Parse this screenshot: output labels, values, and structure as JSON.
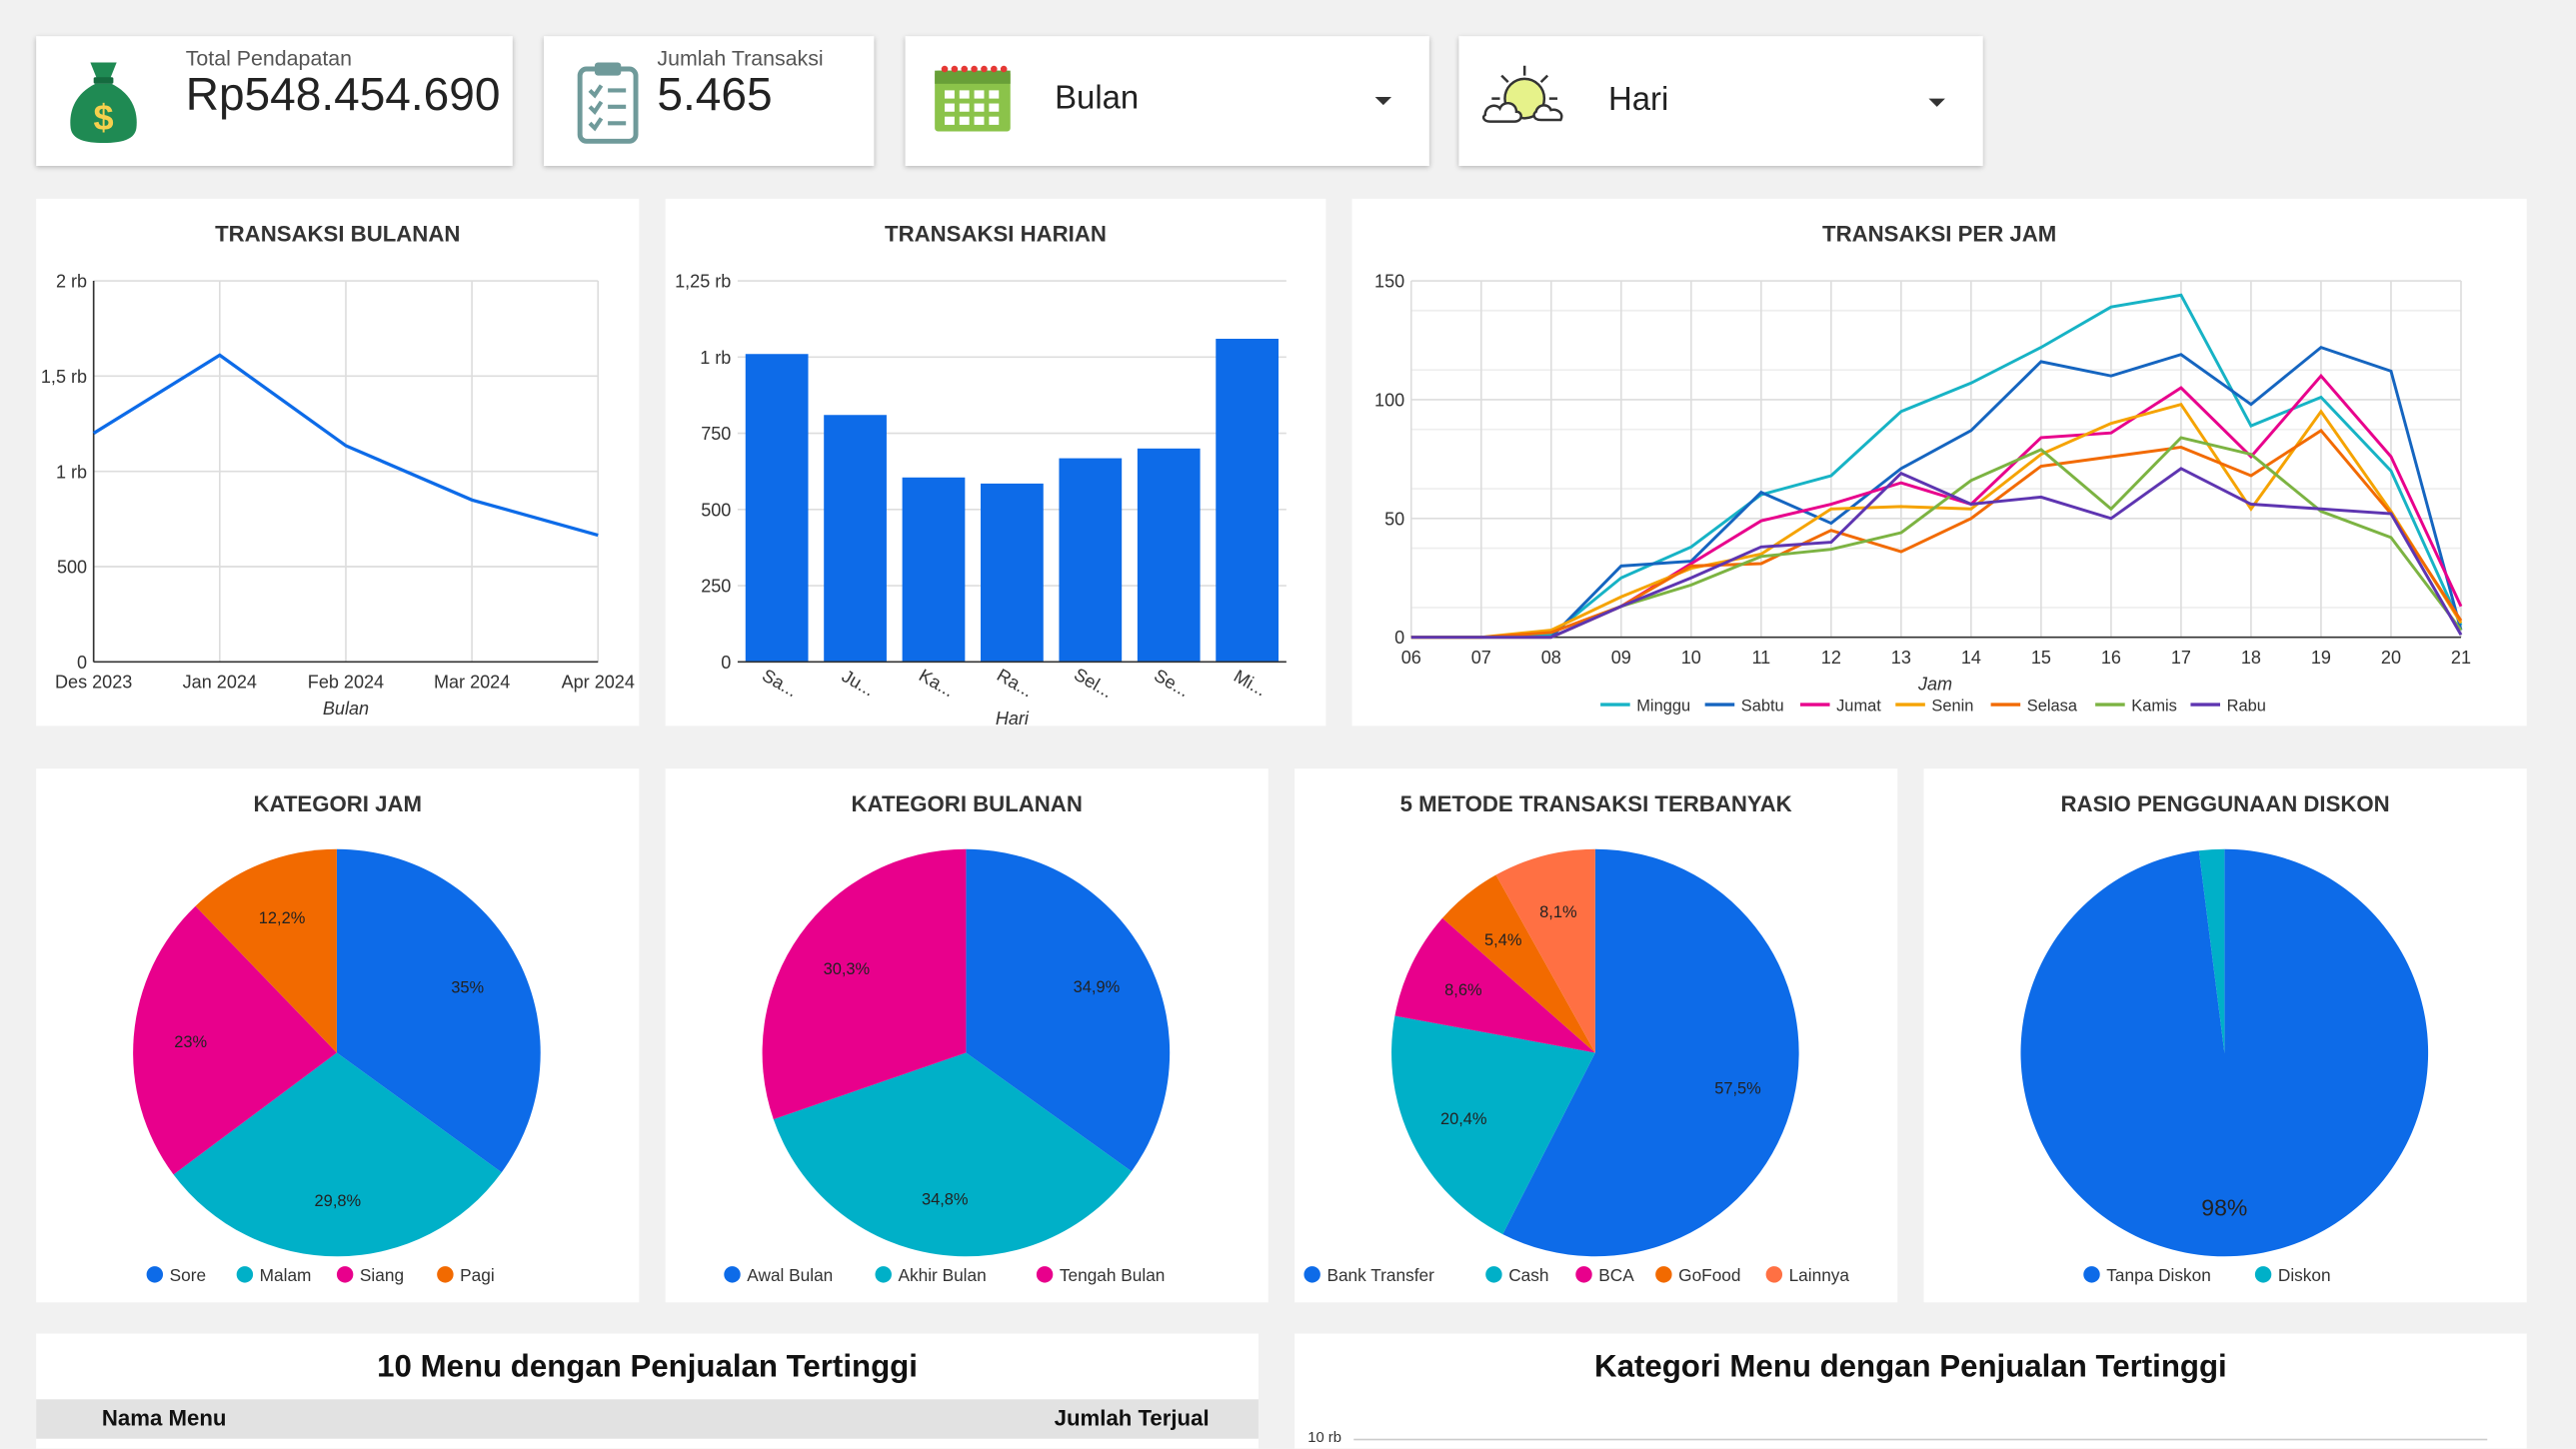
{
  "kpis": {
    "revenue": {
      "label": "Total Pendapatan",
      "value": "Rp548.454.690",
      "icon": "money-bag-icon"
    },
    "transactions": {
      "label": "Jumlah Transaksi",
      "value": "5.465",
      "icon": "clipboard-list-icon"
    }
  },
  "filters": {
    "month": {
      "value": "Bulan",
      "icon": "calendar-icon"
    },
    "day": {
      "value": "Hari",
      "icon": "sun-cloud-icon"
    }
  },
  "colors": {
    "blue": "#0d6be8",
    "teal": "#00b0c8",
    "pink": "#e8008c",
    "orange": "#f26a00",
    "amber": "#f5a300",
    "coral": "#ff7043",
    "green": "#7cb342",
    "purple": "#5e35b1",
    "darkblue": "#1565c0",
    "cyan": "#17b3c5"
  },
  "chart_data": [
    {
      "id": "monthly",
      "type": "line",
      "title": "TRANSAKSI BULANAN",
      "xlabel": "Bulan",
      "ylabel": "",
      "categories": [
        "Des 2023",
        "Jan 2024",
        "Feb 2024",
        "Mar 2024",
        "Apr 2024"
      ],
      "values": [
        1200,
        1610,
        1135,
        850,
        665
      ],
      "ylim": [
        0,
        2000
      ],
      "yticks": [
        0,
        500,
        1000,
        1500,
        2000
      ],
      "ytick_labels": [
        "0",
        "500",
        "1 rb",
        "1,5 rb",
        "2 rb"
      ],
      "grid": true,
      "color": "#0d6be8"
    },
    {
      "id": "daily",
      "type": "bar",
      "title": "TRANSAKSI HARIAN",
      "xlabel": "Hari",
      "ylabel": "",
      "categories": [
        "Sa...",
        "Ju...",
        "Ka...",
        "Ra...",
        "Sel...",
        "Se...",
        "Mi..."
      ],
      "values": [
        1010,
        810,
        605,
        585,
        668,
        700,
        1060
      ],
      "ylim": [
        0,
        1250
      ],
      "yticks": [
        0,
        250,
        500,
        750,
        1000,
        1250
      ],
      "ytick_labels": [
        "0",
        "250",
        "500",
        "750",
        "1 rb",
        "1,25 rb"
      ],
      "grid": true,
      "color": "#0d6be8"
    },
    {
      "id": "hourly",
      "type": "line",
      "title": "TRANSAKSI PER JAM",
      "xlabel": "Jam",
      "ylabel": "",
      "categories": [
        "06",
        "07",
        "08",
        "09",
        "10",
        "11",
        "12",
        "13",
        "14",
        "15",
        "16",
        "17",
        "18",
        "19",
        "20",
        "21"
      ],
      "ylim": [
        0,
        150
      ],
      "yticks": [
        0,
        50,
        100,
        150
      ],
      "ytick_labels": [
        "0",
        "50",
        "100",
        "150"
      ],
      "grid": true,
      "legend": "bottom",
      "series": [
        {
          "name": "Minggu",
          "color": "#17b3c5",
          "values": [
            0,
            0,
            1,
            25,
            38,
            60,
            68,
            95,
            107,
            122,
            139,
            144,
            89,
            101,
            70,
            5
          ]
        },
        {
          "name": "Sabtu",
          "color": "#1565c0",
          "values": [
            0,
            0,
            0,
            30,
            32,
            61,
            48,
            71,
            87,
            116,
            110,
            119,
            98,
            122,
            112,
            3
          ]
        },
        {
          "name": "Jumat",
          "color": "#e8008c",
          "values": [
            0,
            0,
            0,
            13,
            31,
            49,
            56,
            65,
            56,
            84,
            86,
            105,
            76,
            110,
            76,
            13
          ]
        },
        {
          "name": "Senin",
          "color": "#f5a300",
          "values": [
            0,
            0,
            3,
            17,
            29,
            35,
            54,
            55,
            54,
            77,
            90,
            98,
            54,
            95,
            53,
            6
          ]
        },
        {
          "name": "Selasa",
          "color": "#f26a00",
          "values": [
            0,
            0,
            2,
            13,
            30,
            31,
            45,
            36,
            50,
            72,
            76,
            80,
            68,
            87,
            52,
            7
          ]
        },
        {
          "name": "Kamis",
          "color": "#7cb342",
          "values": [
            0,
            0,
            0,
            13,
            22,
            34,
            37,
            44,
            66,
            79,
            54,
            84,
            77,
            53,
            42,
            3
          ]
        },
        {
          "name": "Rabu",
          "color": "#5e35b1",
          "values": [
            0,
            0,
            0,
            13,
            25,
            38,
            40,
            69,
            56,
            59,
            50,
            71,
            56,
            54,
            52,
            1
          ]
        }
      ]
    },
    {
      "id": "hour-category",
      "type": "pie",
      "title": "KATEGORI JAM",
      "legend": "bottom",
      "slices": [
        {
          "name": "Sore",
          "value": 35,
          "label": "35%",
          "color": "#0d6be8"
        },
        {
          "name": "Malam",
          "value": 29.8,
          "label": "29,8%",
          "color": "#00b0c8"
        },
        {
          "name": "Siang",
          "value": 23,
          "label": "23%",
          "color": "#e8008c"
        },
        {
          "name": "Pagi",
          "value": 12.2,
          "label": "12,2%",
          "color": "#f26a00"
        }
      ]
    },
    {
      "id": "month-category",
      "type": "pie",
      "title": "KATEGORI BULANAN",
      "legend": "bottom",
      "slices": [
        {
          "name": "Awal Bulan",
          "value": 34.9,
          "label": "34,9%",
          "color": "#0d6be8"
        },
        {
          "name": "Akhir Bulan",
          "value": 34.8,
          "label": "34,8%",
          "color": "#00b0c8"
        },
        {
          "name": "Tengah Bulan",
          "value": 30.3,
          "label": "30,3%",
          "color": "#e8008c"
        }
      ]
    },
    {
      "id": "payment-methods",
      "type": "pie",
      "title": "5 METODE TRANSAKSI TERBANYAK",
      "legend": "bottom",
      "slices": [
        {
          "name": "Bank Transfer",
          "value": 57.5,
          "label": "57,5%",
          "color": "#0d6be8"
        },
        {
          "name": "Cash",
          "value": 20.4,
          "label": "20,4%",
          "color": "#00b0c8"
        },
        {
          "name": "BCA",
          "value": 8.6,
          "label": "8,6%",
          "color": "#e8008c"
        },
        {
          "name": "GoFood",
          "value": 5.4,
          "label": "5,4%",
          "color": "#f26a00"
        },
        {
          "name": "Lainnya",
          "value": 8.1,
          "label": "8,1%",
          "color": "#ff7043"
        }
      ]
    },
    {
      "id": "discount-ratio",
      "type": "pie",
      "title": "RASIO PENGGUNAAN DISKON",
      "legend": "bottom",
      "slices": [
        {
          "name": "Tanpa Diskon",
          "value": 98,
          "label": "98%",
          "color": "#0d6be8"
        },
        {
          "name": "Diskon",
          "value": 2,
          "label": "",
          "color": "#00b0c8"
        }
      ]
    }
  ],
  "top_menu_table": {
    "title": "10 Menu dengan Penjualan Tertinggi",
    "columns": [
      "Nama Menu",
      "Jumlah Terjual"
    ]
  },
  "category_chart": {
    "title": "Kategori Menu dengan Penjualan Tertinggi",
    "first_tick": "10 rb"
  }
}
